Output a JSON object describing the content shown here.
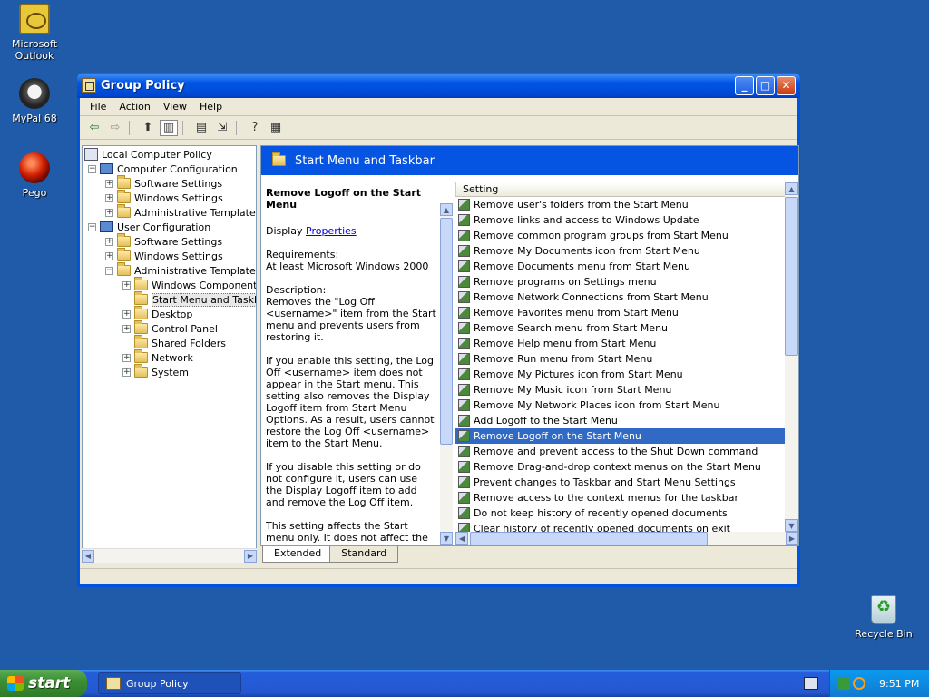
{
  "desktop": {
    "icons": [
      {
        "label": "Microsoft Outlook",
        "icon": "outlook-icon"
      },
      {
        "label": "MyPal 68",
        "icon": "mypal-icon"
      },
      {
        "label": "Pego",
        "icon": "pego-icon"
      },
      {
        "label": "Recycle Bin",
        "icon": "recycle-bin-icon"
      }
    ]
  },
  "window": {
    "title": "Group Policy",
    "buttons": [
      "minimize",
      "maximize",
      "close"
    ],
    "menu": [
      "File",
      "Action",
      "View",
      "Help"
    ]
  },
  "tree": {
    "items": [
      {
        "label": "Local Computer Policy"
      },
      {
        "label": "Computer Configuration"
      },
      {
        "label": "Software Settings"
      },
      {
        "label": "Windows Settings"
      },
      {
        "label": "Administrative Templates"
      },
      {
        "label": "User Configuration"
      },
      {
        "label": "Software Settings"
      },
      {
        "label": "Windows Settings"
      },
      {
        "label": "Administrative Templates"
      },
      {
        "label": "Windows Components"
      },
      {
        "label": "Start Menu and Taskbar"
      },
      {
        "label": "Desktop"
      },
      {
        "label": "Control Panel"
      },
      {
        "label": "Shared Folders"
      },
      {
        "label": "Network"
      },
      {
        "label": "System"
      }
    ]
  },
  "details": {
    "header": "Start Menu and Taskbar",
    "title": "Remove Logoff on the Start Menu",
    "display_prefix": "Display",
    "display_link": "Properties",
    "requirements_label": "Requirements:",
    "requirements": "At least Microsoft Windows 2000",
    "description_label": "Description:",
    "paragraphs": [
      "Removes the \"Log Off <username>\" item from the Start menu and prevents users from restoring it.",
      "If you enable this setting, the Log Off <username> item does not appear in the Start menu. This setting also removes the Display Logoff item from Start Menu Options. As a result, users cannot restore the Log Off <username> item to the Start Menu.",
      "If you disable this setting or do not configure it, users can use the Display Logoff item to add and remove the Log Off item.",
      "This setting affects the Start menu only. It does not affect the Log Off item on the Windows Security dialog box that appears when you press Ctrl+Alt+Del, and it does not prevent"
    ]
  },
  "settings": {
    "column": "Setting",
    "selected_index": 15,
    "items": [
      "Remove user's folders from the Start Menu",
      "Remove links and access to Windows Update",
      "Remove common program groups from Start Menu",
      "Remove My Documents icon from Start Menu",
      "Remove Documents menu from Start Menu",
      "Remove programs on Settings menu",
      "Remove Network Connections from Start Menu",
      "Remove Favorites menu from Start Menu",
      "Remove Search menu from Start Menu",
      "Remove Help menu from Start Menu",
      "Remove Run menu from Start Menu",
      "Remove My Pictures icon from Start Menu",
      "Remove My Music icon from Start Menu",
      "Remove My Network Places icon from Start Menu",
      "Add Logoff to the Start Menu",
      "Remove Logoff on the Start Menu",
      "Remove and prevent access to the Shut Down command",
      "Remove Drag-and-drop context menus on the Start Menu",
      "Prevent changes to Taskbar and Start Menu Settings",
      "Remove access to the context menus for the taskbar",
      "Do not keep history of recently opened documents",
      "Clear history of recently opened documents on exit"
    ]
  },
  "tabs": [
    "Extended",
    "Standard"
  ],
  "taskbar": {
    "start_label": "start",
    "task_label": "Group Policy",
    "clock": "9:51 PM"
  }
}
